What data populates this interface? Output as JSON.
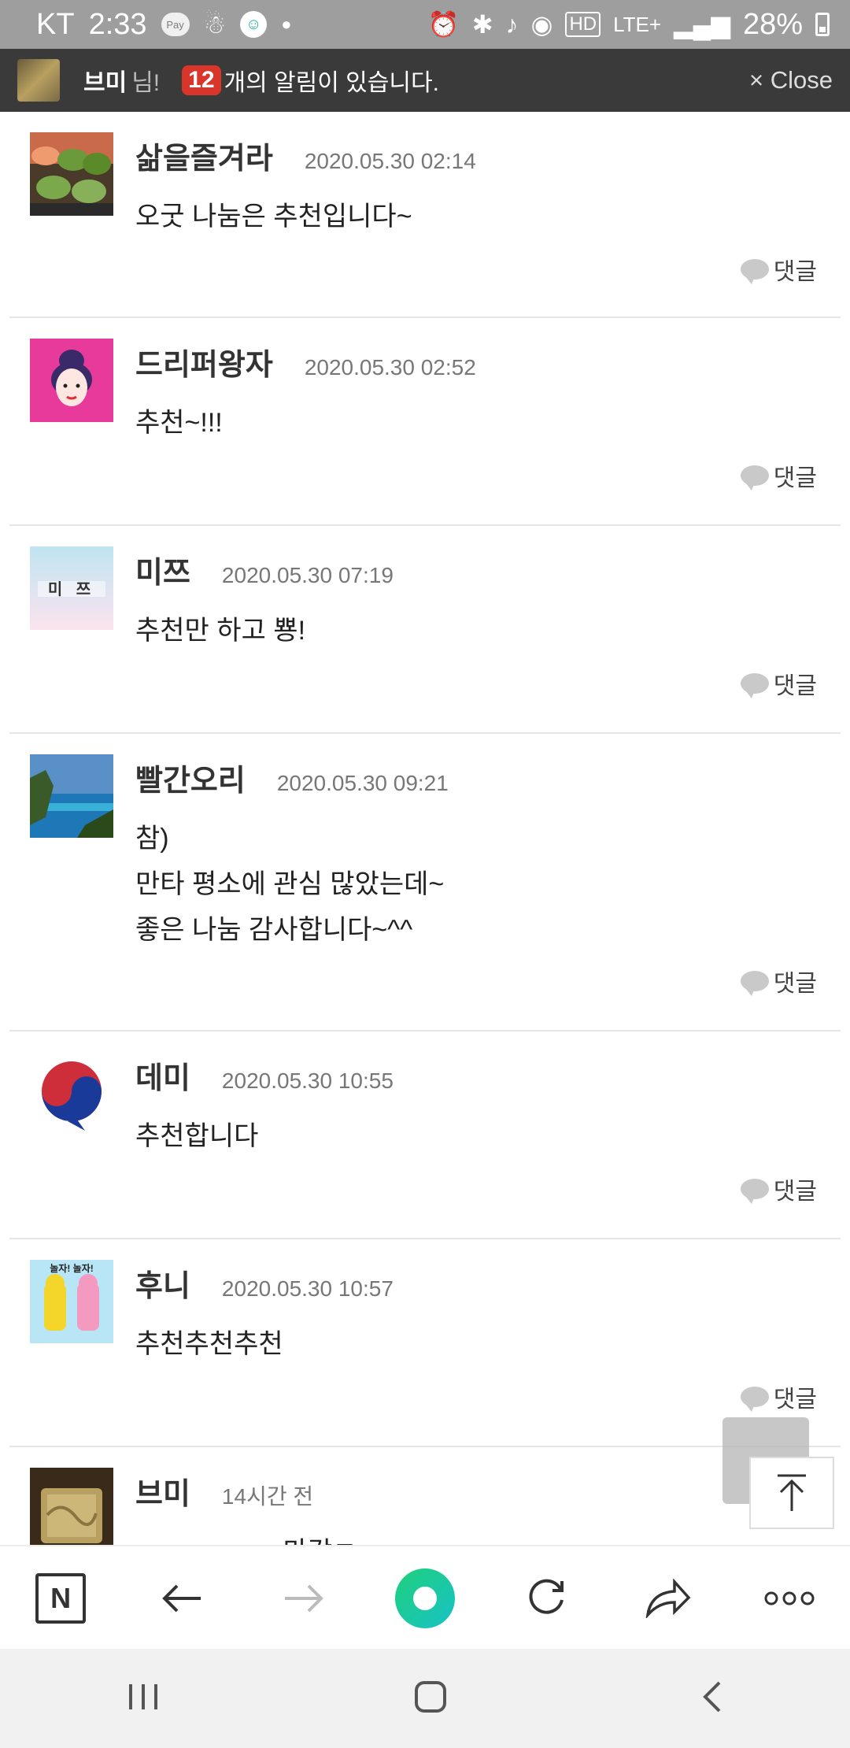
{
  "status_bar": {
    "carrier": "KT",
    "time": "2:33",
    "pay_label": "Pay",
    "network": "LTE+",
    "hd": "HD",
    "battery": "28%"
  },
  "notification": {
    "user": "브미",
    "suffix": "님!",
    "count": "12",
    "message": "개의 알림이 있습니다.",
    "close": "× Close"
  },
  "comments": [
    {
      "name": "삶을즐겨라",
      "date": "2020.05.30 02:14",
      "lines": [
        "오굿 나눔은 추천입니다~"
      ],
      "reply": "댓글"
    },
    {
      "name": "드리퍼왕자",
      "date": "2020.05.30 02:52",
      "lines": [
        "추천~!!!"
      ],
      "reply": "댓글"
    },
    {
      "name": "미쯔",
      "date": "2020.05.30 07:19",
      "lines": [
        "추천만 하고 뿅!"
      ],
      "reply": "댓글",
      "avatar_text": "미 쯔"
    },
    {
      "name": "빨간오리",
      "date": "2020.05.30 09:21",
      "lines": [
        "참)",
        "만타 평소에 관심 많았는데~",
        "좋은 나눔 감사합니다~^^"
      ],
      "reply": "댓글"
    },
    {
      "name": "데미",
      "date": "2020.05.30 10:55",
      "lines": [
        "추천합니다"
      ],
      "reply": "댓글"
    },
    {
      "name": "후니",
      "date": "2020.05.30 10:57",
      "lines": [
        "추천추천추천"
      ],
      "reply": "댓글",
      "avatar_text": "놀자! 놀자!"
    },
    {
      "name": "브미",
      "date": "14시간 전",
      "lines": [
        "ㅡㅡㅡㅡㅡㅡ마감ㅁㅡㅡㅡㅡㅡㅡ"
      ],
      "reply": ""
    }
  ],
  "browser_bar": {
    "icons": [
      "naver-home-icon",
      "back-arrow-icon",
      "forward-arrow-icon",
      "green-dot-icon",
      "refresh-icon",
      "share-icon",
      "more-icon"
    ],
    "home_letter": "N"
  },
  "colors": {
    "badge": "#d9362b",
    "accent_green": "#1fd07a",
    "noti_bg": "#3a3a3a"
  }
}
